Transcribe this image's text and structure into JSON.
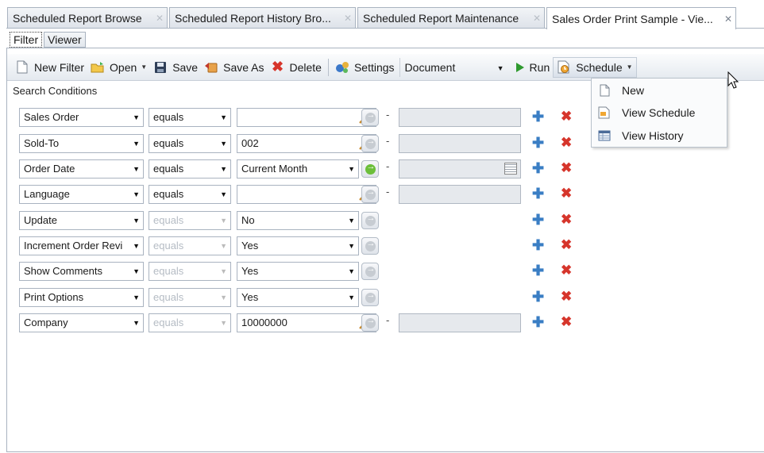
{
  "doc_tabs": [
    {
      "label": "Scheduled Report Browse",
      "active": false
    },
    {
      "label": "Scheduled Report History Bro...",
      "active": false
    },
    {
      "label": "Scheduled Report Maintenance",
      "active": false
    },
    {
      "label": "Sales Order Print Sample - Vie...",
      "active": true
    }
  ],
  "sub_tabs": [
    "Filter",
    "Viewer"
  ],
  "toolbar": {
    "new_filter": "New Filter",
    "open": "Open",
    "save": "Save",
    "save_as": "Save As",
    "delete": "Delete",
    "settings": "Settings",
    "output_select": "Document",
    "run": "Run",
    "schedule": "Schedule"
  },
  "section_title": "Search Conditions",
  "rows": [
    {
      "field": "Sales Order",
      "op": "equals",
      "value": "",
      "value2": true
    },
    {
      "field": "Sold-To",
      "op": "equals",
      "value": "002",
      "value2": true
    },
    {
      "field": "Order Date",
      "op": "equals",
      "value": "Current Month",
      "value2": true
    },
    {
      "field": "Language",
      "op": "equals",
      "value": "",
      "value2": true
    },
    {
      "field": "Update",
      "op": "equals",
      "value": "No",
      "value2": false
    },
    {
      "field": "Increment Order Revi",
      "op": "equals",
      "value": "Yes",
      "value2": false
    },
    {
      "field": "Show Comments",
      "op": "equals",
      "value": "Yes",
      "value2": false
    },
    {
      "field": "Print Options",
      "op": "equals",
      "value": "Yes",
      "value2": false
    },
    {
      "field": "Company",
      "op": "equals",
      "value": "10000000",
      "value2": true
    }
  ],
  "menu": {
    "new": "New",
    "view_schedule": "View Schedule",
    "view_history": "View History"
  },
  "colors": {
    "add": "#3a7ec4",
    "remove": "#d6352b",
    "run": "#2f9a2f"
  }
}
